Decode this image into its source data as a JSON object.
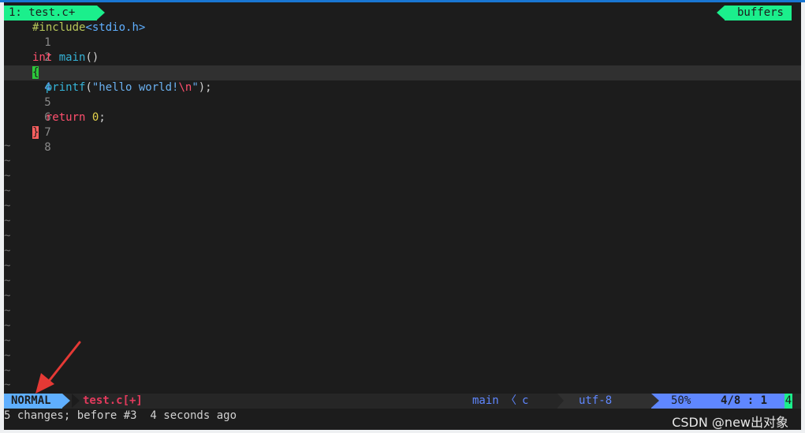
{
  "tabline": {
    "active_tab": "1: test.c+",
    "buffers_label": "buffers"
  },
  "buffer": {
    "lines": [
      {
        "num": "1"
      },
      {
        "num": "2"
      },
      {
        "num": "3"
      },
      {
        "num": "4"
      },
      {
        "num": "5"
      },
      {
        "num": "6"
      },
      {
        "num": "7"
      },
      {
        "num": "8"
      }
    ],
    "tokens": {
      "l1_directive": "#include",
      "l1_header": "<stdio.h>",
      "l3_type": "int",
      "l3_func": "main",
      "l3_parens": "()",
      "l4_brace": "{",
      "l5_indent": "  ",
      "l5_func": "printf",
      "l5_open": "(",
      "l5_str": "\"hello world!",
      "l5_esc": "\\n",
      "l5_strend": "\"",
      "l5_close": ");",
      "l7_indent": "  ",
      "l7_kw": "return",
      "l7_sp": " ",
      "l7_num": "0",
      "l7_semi": ";",
      "l8_brace": "}"
    },
    "empty_marker": "~",
    "colors": {
      "background": "#1c1c1c",
      "keyword": "#ff4f6d",
      "function": "#34b3d7",
      "string": "#6ab0f0",
      "number": "#e3d14b",
      "preprocessor": "#b8c85a"
    }
  },
  "statusline": {
    "mode": "NORMAL",
    "filename": "test.c[+]",
    "function": "main",
    "separator": "〈",
    "filetype": "c",
    "encoding": "utf-8",
    "percent": "50%",
    "position": "4/8 :  1",
    "column_indicator": "4",
    "colors": {
      "mode_bg": "#5fafff",
      "accent": "#1bef8c",
      "position_bg": "#5f87ff"
    }
  },
  "cmdline": {
    "message": "5 changes; before #3  4 seconds ago"
  },
  "watermark": {
    "text": "CSDN @new出对象"
  },
  "annotation": {
    "icon": "red-arrow-icon",
    "color": "#e53935"
  }
}
